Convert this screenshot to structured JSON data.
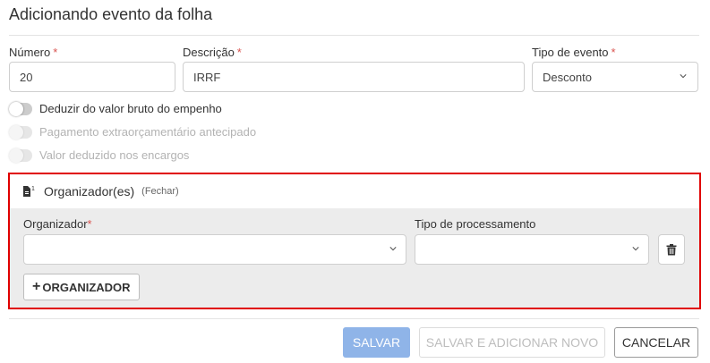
{
  "page": {
    "title": "Adicionando evento da folha"
  },
  "form": {
    "numero": {
      "label": "Número",
      "required_mark": "*",
      "value": "20"
    },
    "descricao": {
      "label": "Descrição",
      "required_mark": "*",
      "value": "IRRF"
    },
    "tipo_evento": {
      "label": "Tipo de evento",
      "required_mark": "*",
      "value": "Desconto"
    },
    "toggles": [
      {
        "label": "Deduzir do valor bruto do empenho",
        "on": false,
        "disabled": false
      },
      {
        "label": "Pagamento extraorçamentário antecipado",
        "on": false,
        "disabled": true
      },
      {
        "label": "Valor deduzido nos encargos",
        "on": false,
        "disabled": true
      }
    ]
  },
  "organizadores": {
    "badge": "1",
    "title": "Organizador(es)",
    "close_label": "(Fechar)",
    "organizador": {
      "label": "Organizador",
      "required_mark": "*",
      "value": ""
    },
    "tipo_processamento": {
      "label": "Tipo de processamento",
      "value": ""
    },
    "add_button": {
      "plus": "+",
      "label": "ORGANIZADOR"
    },
    "icons": {
      "section": "document-icon",
      "delete": "trash-icon"
    }
  },
  "footer": {
    "save": "SALVAR",
    "save_new": "SALVAR E ADICIONAR NOVO",
    "cancel": "CANCELAR"
  },
  "colors": {
    "highlight_border": "#e00000",
    "primary_disabled": "#8fb4e8",
    "required": "#d9534f",
    "section_bg": "#ececec"
  }
}
